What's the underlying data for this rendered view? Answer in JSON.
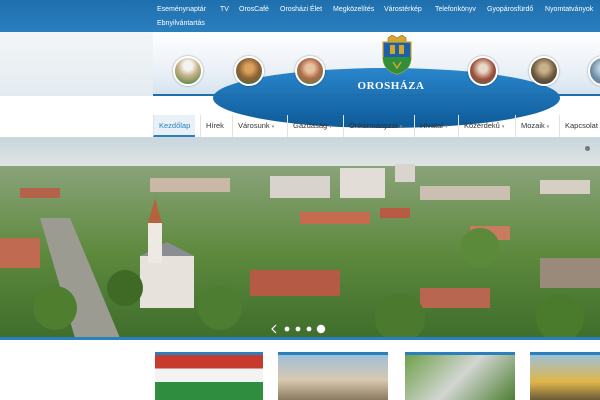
{
  "top_nav": {
    "items": [
      {
        "label": "Eseménynaptár"
      },
      {
        "label": "TV"
      },
      {
        "label": "OrosCafé"
      },
      {
        "label": "Orosházi Élet"
      },
      {
        "label": "Megközelítés"
      },
      {
        "label": "Várostérkép"
      },
      {
        "label": "Telefonkönyv"
      },
      {
        "label": "Gyopárosfürdő"
      },
      {
        "label": "Nyomtatványok"
      },
      {
        "label": "Ebnyilvántartás"
      }
    ]
  },
  "header": {
    "town_name": "OROSHÁZA",
    "brand_color": "#2a7fbf"
  },
  "main_nav": {
    "items": [
      {
        "label": "Kezdőlap",
        "active": true
      },
      {
        "label": "Hírek"
      },
      {
        "label": "Városunk",
        "dropdown": true
      },
      {
        "label": "Gazdaság",
        "dropdown": true
      },
      {
        "label": "Önkormányzat",
        "dropdown": true
      },
      {
        "label": "Hivatal",
        "dropdown": true
      },
      {
        "label": "Közérdekű",
        "dropdown": true
      },
      {
        "label": "Mozaik",
        "dropdown": true
      },
      {
        "label": "Kapcsolat"
      }
    ]
  },
  "slider": {
    "slide_count": 4,
    "active_index": 3,
    "caret": "▾"
  }
}
